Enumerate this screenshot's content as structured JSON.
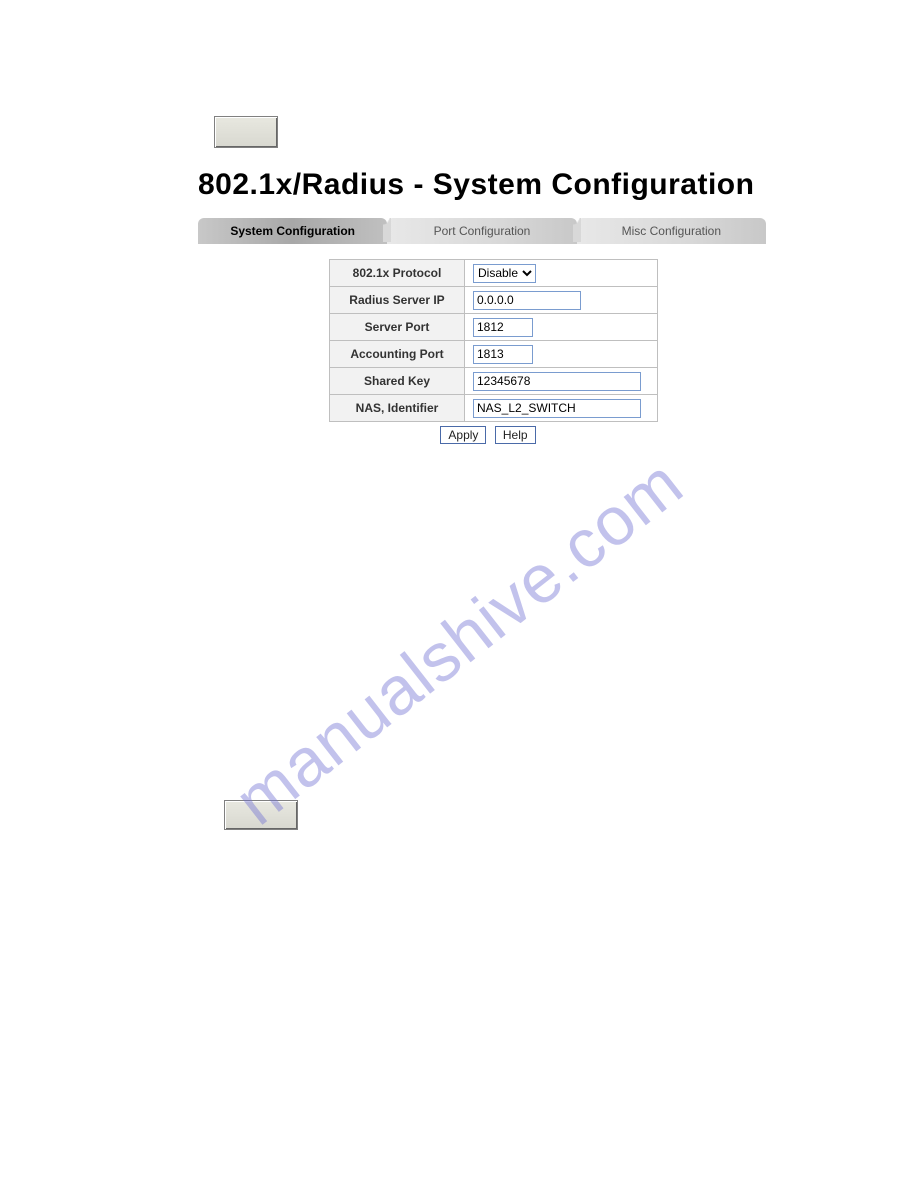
{
  "title": "802.1x/Radius - System Configuration",
  "tabs": {
    "system": "System Configuration",
    "port": "Port Configuration",
    "misc": "Misc Configuration"
  },
  "form": {
    "labels": {
      "protocol": "802.1x Protocol",
      "radius_ip": "Radius Server IP",
      "server_port": "Server Port",
      "accounting_port": "Accounting Port",
      "shared_key": "Shared Key",
      "nas_identifier": "NAS, Identifier"
    },
    "values": {
      "protocol_selected": "Disable",
      "protocol_options": [
        "Disable"
      ],
      "radius_ip": "0.0.0.0",
      "server_port": "1812",
      "accounting_port": "1813",
      "shared_key": "12345678",
      "nas_identifier": "NAS_L2_SWITCH"
    }
  },
  "buttons": {
    "apply": "Apply",
    "help": "Help"
  },
  "watermark": "manualshive.com"
}
